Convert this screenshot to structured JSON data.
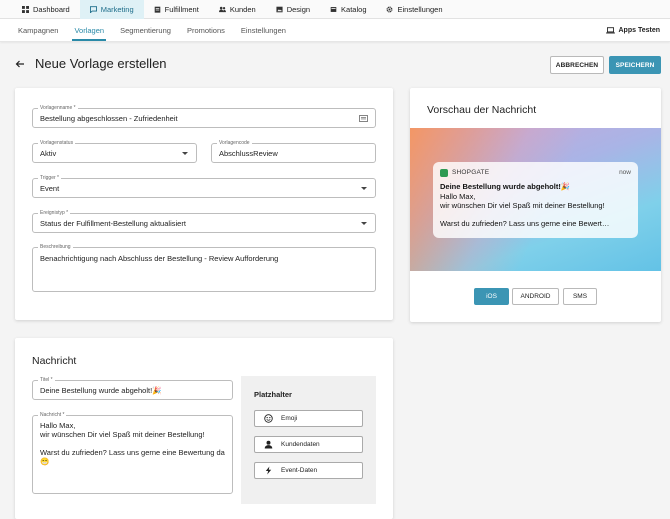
{
  "topnav": {
    "items": [
      {
        "label": "Dashboard",
        "icon": "grid-icon",
        "active": false
      },
      {
        "label": "Marketing",
        "icon": "chat-icon",
        "active": true
      },
      {
        "label": "Fulfillment",
        "icon": "clipboard-icon",
        "active": false
      },
      {
        "label": "Kunden",
        "icon": "people-icon",
        "active": false
      },
      {
        "label": "Design",
        "icon": "image-icon",
        "active": false
      },
      {
        "label": "Katalog",
        "icon": "book-icon",
        "active": false
      },
      {
        "label": "Einstellungen",
        "icon": "gear-icon",
        "active": false
      }
    ]
  },
  "subnav": {
    "items": [
      {
        "label": "Kampagnen",
        "active": false
      },
      {
        "label": "Vorlagen",
        "active": true
      },
      {
        "label": "Segmentierung",
        "active": false
      },
      {
        "label": "Promotions",
        "active": false
      },
      {
        "label": "Einstellungen",
        "active": false
      }
    ],
    "apps_test_label": "Apps Testen",
    "apps_test_icon": "laptop-icon"
  },
  "header": {
    "title": "Neue Vorlage erstellen",
    "cancel_label": "ABBRECHEN",
    "save_label": "SPEICHERN"
  },
  "form": {
    "template_name": {
      "label": "Vorlagenname *",
      "value": "Bestellung abgeschlossen - Zufriedenheit"
    },
    "template_status": {
      "label": "Vorlagenstatus",
      "value": "Aktiv"
    },
    "template_code": {
      "label": "Vorlagencode",
      "value": "AbschlussReview"
    },
    "trigger": {
      "label": "Trigger *",
      "value": "Event"
    },
    "event_type": {
      "label": "Ereignistyp *",
      "value": "Status der Fulfillment-Bestellung aktualisiert"
    },
    "description": {
      "label": "Beschreibung",
      "value": "Benachrichtigung nach Abschluss der Bestellung - Review Aufforderung"
    }
  },
  "preview": {
    "title": "Vorschau der Nachricht",
    "notification": {
      "app_name": "SHOPGATE",
      "time": "now",
      "title": "Deine Bestellung wurde abgeholt!🎉",
      "line1": "Hallo Max,",
      "line2": "wir wünschen Dir viel Spaß mit deiner Bestellung!",
      "line3": "Warst du zufrieden? Lass uns gerne eine Bewert…"
    },
    "platforms": [
      {
        "label": "iOS",
        "active": true
      },
      {
        "label": "ANDROID",
        "active": false
      },
      {
        "label": "SMS",
        "active": false
      }
    ]
  },
  "message": {
    "heading": "Nachricht",
    "title_field": {
      "label": "Titel *",
      "value": "Deine Bestellung wurde abgeholt!🎉"
    },
    "body_field": {
      "label": "Nachricht *",
      "line1": "Hallo Max,",
      "line2": "wir wünschen Dir viel Spaß mit deiner Bestellung!",
      "line3": "Warst du zufrieden? Lass uns gerne eine Bewertung da",
      "line4": "😁"
    },
    "placeholders": {
      "title": "Platzhalter",
      "buttons": [
        {
          "label": "Emoji",
          "icon": "smiley-icon"
        },
        {
          "label": "Kundendaten",
          "icon": "person-icon"
        },
        {
          "label": "Event-Daten",
          "icon": "bolt-icon"
        }
      ]
    }
  }
}
